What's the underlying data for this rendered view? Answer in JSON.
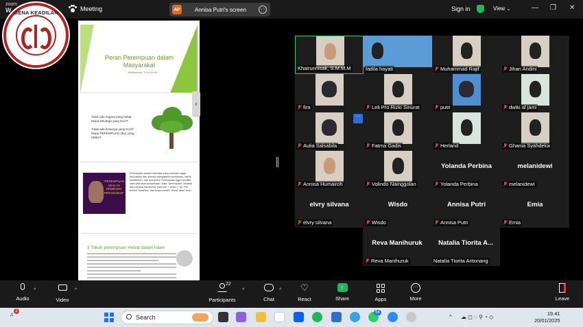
{
  "app": {
    "zoom_logo_line1": "zoom",
    "zoom_logo_line2": "W",
    "meeting_label": "Meeting",
    "share_badge": "AP",
    "share_text": "Annisa Putri's screen",
    "signin": "Sign in",
    "view": "View",
    "win_min": "—",
    "win_max": "❐",
    "win_close": "✕"
  },
  "logo": {
    "text": "GENA KEADILAN",
    "color": "#b0231e"
  },
  "slides": {
    "slide1_title": "Peran Perempuan dalam Masyarakat",
    "slide1_author": "Mahasiswa, S.Pd, M.Pd",
    "slide2_line1": "Tidak ada negara yang hebat",
    "slide2_line2": "tanpa keluarga yang KUAT",
    "slide2_line3": "Tidak ada keluarga yang KUAT",
    "slide2_line4": "tanpa PEREMPUAN (Ibu) yang",
    "slide2_line5": "HEBAT",
    "slide3_quote": "\"PEREMPUAN ADALAH PEMBAWA PERADABAN\"",
    "slide3_text": "Perempuan adalah manusia yang memiliki organ reproduksi dan mampu mengalami menstruasi, hamil, melahirkan, dan menyusui. Perempuan juga memiliki sifat-sifat khas kewanitaan. Kata \"perempuan\" berasal dari bahasa Sanskerta, yaitu per + empu + an. Per berarti \"makhluk\" dan empu berarti \"mulia\" atau \"tuan\".",
    "slide4_heading": "3 Tokoh perempuan Hebat dalam Islam",
    "collapse_icon": "‹"
  },
  "participants": [
    {
      "name": "Khairunnisak, S.M.M.M",
      "muted": false,
      "active": true,
      "video": true
    },
    {
      "name": "fadila hayati",
      "muted": false,
      "video": true
    },
    {
      "name": "Muhammad Rajif",
      "muted": true,
      "video": true
    },
    {
      "name": "Jihan Andini",
      "muted": true,
      "video": true
    },
    {
      "name": "fira",
      "muted": true,
      "video": true
    },
    {
      "name": "Leli Pro Rizki Sinurat",
      "muted": true,
      "video": true
    },
    {
      "name": "putri",
      "muted": true,
      "video": true
    },
    {
      "name": "dwiki al jami",
      "muted": true,
      "video": true
    },
    {
      "name": "Aulia Salsabila",
      "muted": true,
      "video": true
    },
    {
      "name": "Fatma Gadis",
      "muted": true,
      "video": true
    },
    {
      "name": "Herland",
      "muted": true,
      "video": true
    },
    {
      "name": "Ghania Syahdeka",
      "muted": true,
      "video": true
    },
    {
      "name": "Annisa Humairoh",
      "muted": true,
      "video": true
    },
    {
      "name": "Volindo Nainggolan",
      "muted": true,
      "video": true
    },
    {
      "name": "Yolanda Perbina",
      "muted": true,
      "video": false,
      "big": "Yolanda Perbina"
    },
    {
      "name": "melanidewi",
      "muted": true,
      "video": false,
      "big": "melanidewi"
    },
    {
      "name": "elvry silvana",
      "muted": true,
      "video": false,
      "big": "elvry silvana"
    },
    {
      "name": "Wisdo",
      "muted": true,
      "video": false,
      "big": "Wisdo"
    },
    {
      "name": "Annisa Putri",
      "muted": true,
      "video": false,
      "big": "Annisa Putri"
    },
    {
      "name": "Emia",
      "muted": true,
      "video": false,
      "big": "Emia"
    },
    {
      "name": "Reva Manihuruk",
      "muted": true,
      "video": false,
      "big": "Reva Manihuruk"
    },
    {
      "name": "Natalia Tiorita Aritonang",
      "muted": false,
      "video": false,
      "big": "Natalia Tiorita A..."
    }
  ],
  "tile_more_icon": "···",
  "toolbar": {
    "audio": "Audio",
    "video": "Video",
    "participants": "Participants",
    "participants_count": "22",
    "chat": "Chat",
    "react": "React",
    "share": "Share",
    "apps": "Apps",
    "more": "More",
    "leave": "Leave",
    "caret": "^",
    "heart_icon": "♡",
    "share_arrow": "↑",
    "more_icon": "···"
  },
  "taskbar": {
    "search_placeholder": "Search",
    "time": "19.41",
    "date": "20/01/2025",
    "notif_count": "2",
    "whatsapp_badge": "56",
    "tray_up": "^",
    "tray_icons": "☁ ◻ ◌ ⚲ ◔ ◇"
  }
}
